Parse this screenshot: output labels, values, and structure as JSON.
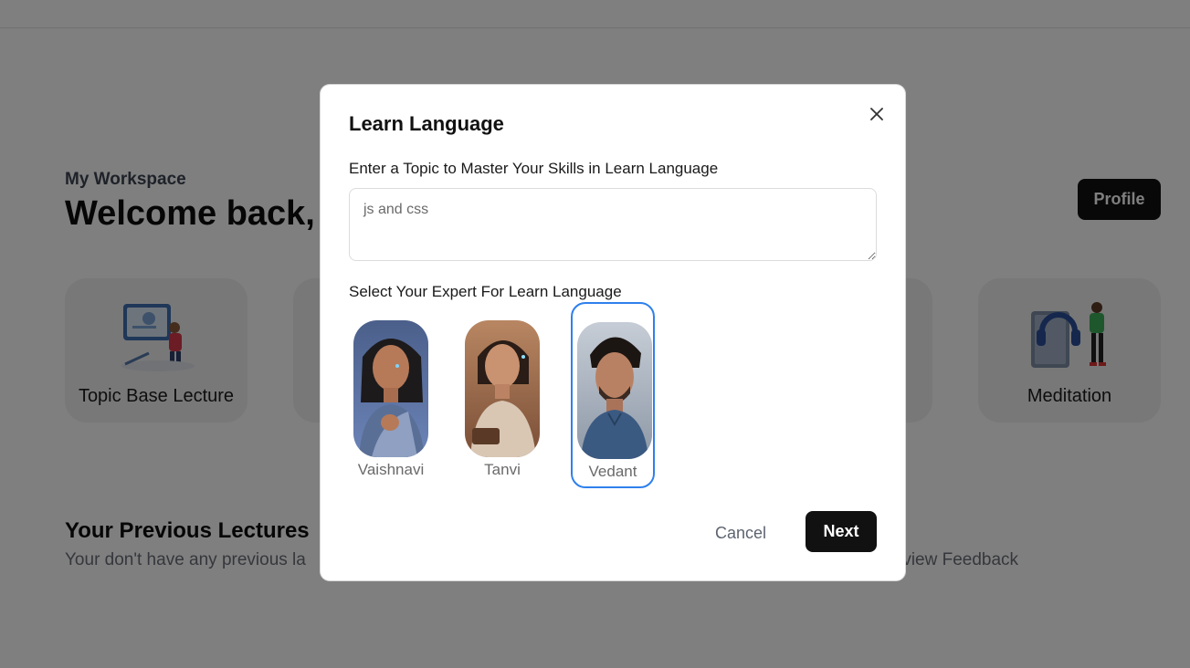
{
  "background": {
    "workspace_label": "My Workspace",
    "welcome": "Welcome back,",
    "profile_button": "Profile",
    "cards": [
      {
        "label": "Topic Base Lecture",
        "icon": "teacher-illustration-icon"
      },
      {
        "label": "Meditation",
        "icon": "headphones-book-illustration-icon"
      }
    ],
    "previous_lectures": {
      "title": "Your Previous Lectures",
      "empty_text": "Your don't have any previous la"
    },
    "feedback_fragment": "rview Feedback"
  },
  "modal": {
    "title": "Learn Language",
    "close_icon": "close-icon",
    "topic_label": "Enter a Topic to Master Your Skills in Learn Language",
    "topic_value": "js and css",
    "expert_label": "Select Your Expert For Learn Language",
    "experts": [
      {
        "name": "Vaishnavi",
        "selected": false
      },
      {
        "name": "Tanvi",
        "selected": false
      },
      {
        "name": "Vedant",
        "selected": true
      }
    ],
    "cancel_label": "Cancel",
    "next_label": "Next"
  },
  "colors": {
    "overlay": "#000000",
    "primary_button": "#111111",
    "selected_border": "#2f80ed"
  }
}
